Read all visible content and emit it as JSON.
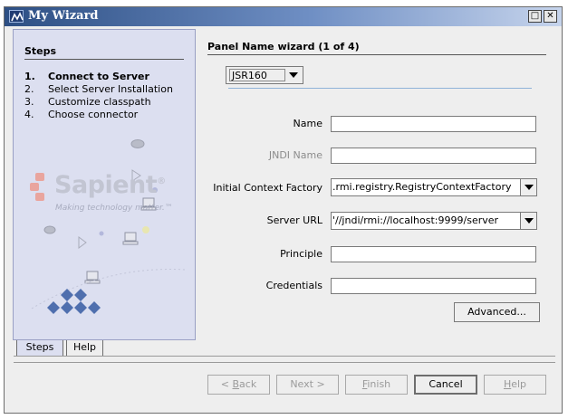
{
  "window": {
    "title": "My Wizard",
    "restore_glyph": "□",
    "close_glyph": "✕"
  },
  "steps": {
    "heading": "Steps",
    "items": [
      {
        "num": "1.",
        "label": "Connect to Server",
        "active": true
      },
      {
        "num": "2.",
        "label": "Select Server Installation",
        "active": false
      },
      {
        "num": "3.",
        "label": "Customize classpath",
        "active": false
      },
      {
        "num": "4.",
        "label": "Choose connector",
        "active": false
      }
    ],
    "logo_name": "Sapient",
    "logo_mark": "®",
    "logo_tagline": "Making technology matter.™",
    "tabs": [
      "Steps",
      "Help"
    ]
  },
  "panel": {
    "title": "Panel Name wizard (1 of 4)",
    "jsr_selected": "JSR160"
  },
  "form": {
    "name_label": "Name",
    "name_value": "",
    "jndi_label": "JNDI Name",
    "jndi_value": "",
    "icf_label": "Initial Context Factory",
    "icf_value": ".rmi.registry.RegistryContextFactory",
    "server_url_label": "Server URL",
    "server_url_value": "'//jndi/rmi://localhost:9999/server",
    "principle_label": "Principle",
    "principle_value": "",
    "credentials_label": "Credentials",
    "credentials_value": "",
    "advanced_label": "Advanced..."
  },
  "buttons": {
    "back": {
      "pre": "< ",
      "mnemonic": "B",
      "post": "ack"
    },
    "next": "Next >",
    "finish": {
      "pre": "",
      "mnemonic": "F",
      "post": "inish"
    },
    "cancel": "Cancel",
    "help": {
      "pre": "",
      "mnemonic": "H",
      "post": "elp"
    }
  },
  "colors": {
    "title_bar": "#2d4f84",
    "steps_panel": "#dcdff0",
    "window_bg": "#eeeeee",
    "disabled_text": "#8c8c8c"
  },
  "icons": [
    "wizard-app-icon",
    "restore-icon",
    "close-icon",
    "dropdown-arrow-icon",
    "sapient-logo-icon",
    "computer-icon",
    "play-arrow-icon",
    "disc-icon"
  ]
}
